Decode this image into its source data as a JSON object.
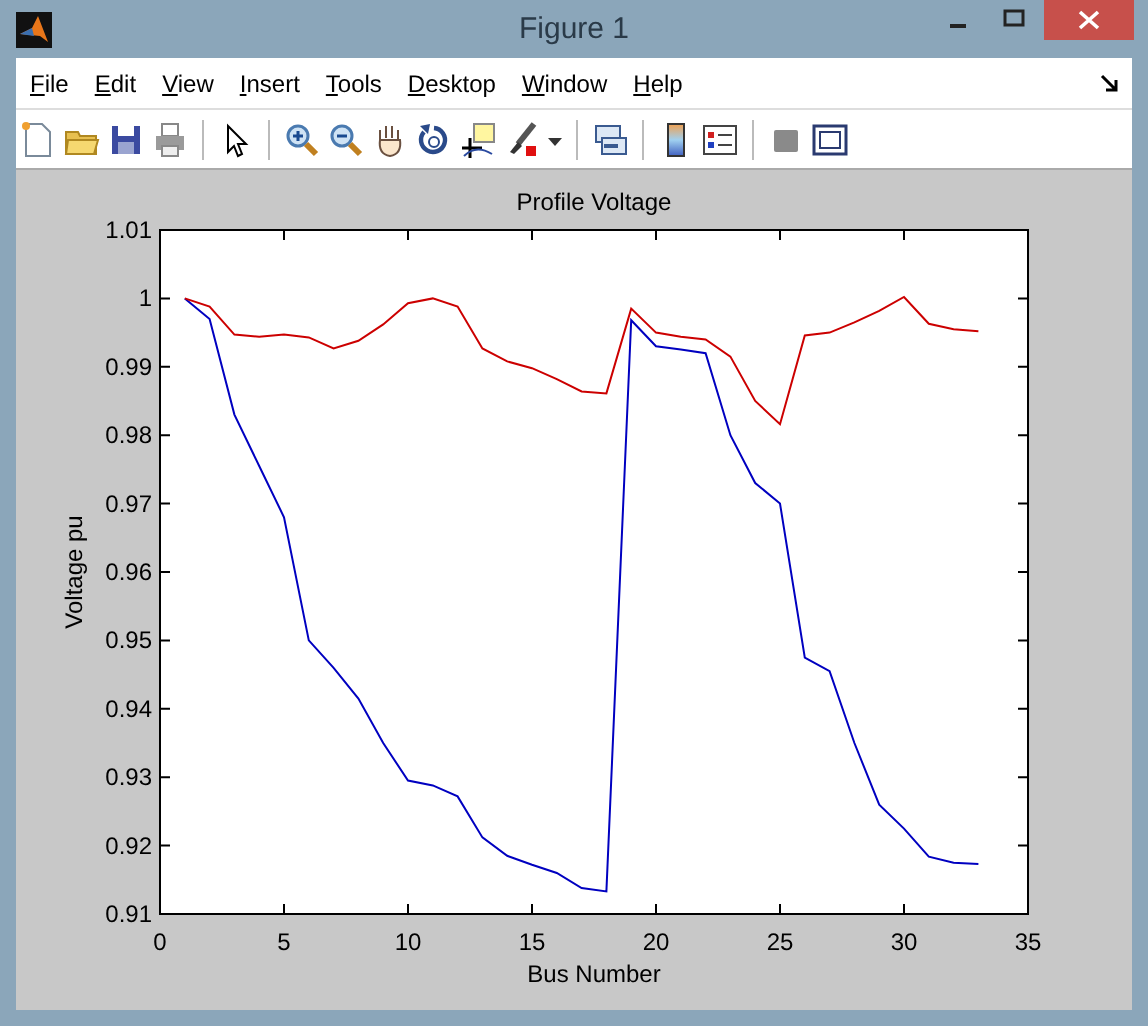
{
  "window": {
    "title": "Figure 1"
  },
  "menu": [
    "File",
    "Edit",
    "View",
    "Insert",
    "Tools",
    "Desktop",
    "Window",
    "Help"
  ],
  "figure": {
    "chart_data": {
      "type": "line",
      "title": "Profile Voltage",
      "xlabel": "Bus Number",
      "ylabel": "Voltage pu",
      "xlim": [
        0,
        35
      ],
      "ylim": [
        0.91,
        1.01
      ],
      "xticks": [
        0,
        5,
        10,
        15,
        20,
        25,
        30,
        35
      ],
      "yticks": [
        {
          "value": 0.91,
          "label": "0.91"
        },
        {
          "value": 0.92,
          "label": "0.92"
        },
        {
          "value": 0.93,
          "label": "0.93"
        },
        {
          "value": 0.94,
          "label": "0.94"
        },
        {
          "value": 0.95,
          "label": "0.95"
        },
        {
          "value": 0.96,
          "label": "0.96"
        },
        {
          "value": 0.97,
          "label": "0.97"
        },
        {
          "value": 0.98,
          "label": "0.98"
        },
        {
          "value": 0.99,
          "label": "0.99"
        },
        {
          "value": 1,
          "label": "1"
        },
        {
          "value": 1.01,
          "label": "1.01"
        }
      ],
      "x": [
        1,
        2,
        3,
        4,
        5,
        6,
        7,
        8,
        9,
        10,
        11,
        12,
        13,
        14,
        15,
        16,
        17,
        18,
        19,
        20,
        21,
        22,
        23,
        24,
        25,
        26,
        27,
        28,
        29,
        30,
        31,
        32,
        33
      ],
      "series": [
        {
          "color": "#0000c0",
          "values": [
            1.0,
            0.997,
            0.983,
            0.9755,
            0.968,
            0.95,
            0.946,
            0.9415,
            0.935,
            0.9295,
            0.9288,
            0.9272,
            0.9212,
            0.9185,
            0.9172,
            0.916,
            0.9138,
            0.9133,
            0.9968,
            0.993,
            0.9925,
            0.992,
            0.98,
            0.973,
            0.97,
            0.9475,
            0.9455,
            0.935,
            0.926,
            0.9225,
            0.9184,
            0.9175,
            0.9173
          ]
        },
        {
          "color": "#cc0000",
          "values": [
            1.0,
            0.9988,
            0.9947,
            0.9944,
            0.9947,
            0.9943,
            0.9927,
            0.9938,
            0.9962,
            0.9993,
            1.0,
            0.9988,
            0.9927,
            0.9908,
            0.9898,
            0.9882,
            0.9864,
            0.9861,
            0.9985,
            0.995,
            0.9944,
            0.994,
            0.9915,
            0.985,
            0.9816,
            0.9946,
            0.995,
            0.9965,
            0.9982,
            1.0002,
            0.9963,
            0.9955,
            0.9952
          ]
        }
      ]
    }
  }
}
